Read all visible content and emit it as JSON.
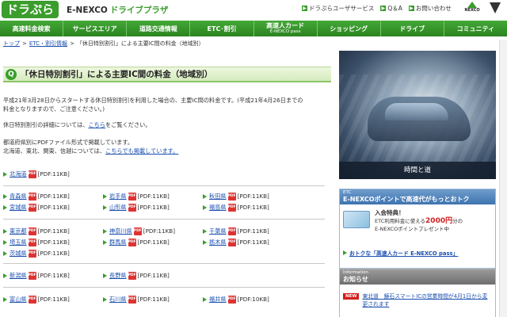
{
  "header": {
    "logo_text": "ドラぷら",
    "brand": "E-NEXCO",
    "brand_sub": "ドライブプラザ",
    "util_links": [
      "ドラぷらユーザサービス",
      "Q＆A",
      "お問い合わせ"
    ],
    "nexco_logo": "NEXCO"
  },
  "nav": {
    "items": [
      {
        "label": "高速料金検索",
        "sub": ""
      },
      {
        "label": "サービスエリア",
        "sub": ""
      },
      {
        "label": "道路交通情報",
        "sub": ""
      },
      {
        "label": "ETC･割引",
        "sub": ""
      },
      {
        "label": "高速人カード",
        "sub": "E-NEXCO pass"
      },
      {
        "label": "ショッピング",
        "sub": ""
      },
      {
        "label": "ドライブ",
        "sub": ""
      },
      {
        "label": "コミュニティ",
        "sub": ""
      }
    ]
  },
  "breadcrumb": {
    "home": "トップ",
    "parent": "ETC・割引情報",
    "current": "「休日特別割引」による主要IC間の料金（地域別）"
  },
  "main": {
    "title": "「休日特別割引」による主要IC間の料金（地域別）",
    "intro_line1": "平成21年3月28日からスタートする休日特別割引を利用した場合の、主要IC間の料金です。(平成21年4月26日までの",
    "intro_line2": "料金となりますので、ご注意ください。)",
    "details_prefix": "休日特別割引の詳細については、",
    "details_link": "こちら",
    "details_suffix": "をご覧ください。",
    "pdf_note": "都道府県別にPDFファイル形式で掲載しています。",
    "region_prefix": "北海道、東北、関東、信越については、",
    "region_link": "こちらでも掲載しています。",
    "pdf_label": "PDF",
    "groups": [
      [
        [
          {
            "name": "北海道",
            "size": "[PDF:11KB]"
          }
        ]
      ],
      [
        [
          {
            "name": "青森県",
            "size": "[PDF:11KB]"
          },
          {
            "name": "宮城県",
            "size": "[PDF:11KB]"
          }
        ],
        [
          {
            "name": "岩手県",
            "size": "[PDF:11KB]"
          },
          {
            "name": "山形県",
            "size": "[PDF:11KB]"
          }
        ],
        [
          {
            "name": "秋田県",
            "size": "[PDF:11KB]"
          },
          {
            "name": "福島県",
            "size": "[PDF:11KB]"
          }
        ]
      ],
      [
        [
          {
            "name": "東京都",
            "size": "[PDF:11KB]"
          },
          {
            "name": "埼玉県",
            "size": "[PDF:11KB]"
          },
          {
            "name": "茨城県",
            "size": "[PDF:11KB]"
          }
        ],
        [
          {
            "name": "神奈川県",
            "size": "[PDF:11KB]"
          },
          {
            "name": "群馬県",
            "size": "[PDF:11KB]"
          }
        ],
        [
          {
            "name": "千葉県",
            "size": "[PDF:11KB]"
          },
          {
            "name": "栃木県",
            "size": "[PDF:11KB]"
          }
        ]
      ],
      [
        [
          {
            "name": "新潟県",
            "size": "[PDF:11KB]"
          }
        ],
        [
          {
            "name": "長野県",
            "size": "[PDF:11KB]"
          }
        ]
      ],
      [
        [
          {
            "name": "富山県",
            "size": "[PDF:11KB]"
          }
        ],
        [
          {
            "name": "石川県",
            "size": "[PDF:11KB]"
          }
        ],
        [
          {
            "name": "福井県",
            "size": "[PDF:10KB]"
          }
        ]
      ]
    ]
  },
  "sidebar": {
    "promo_caption": "時間と道",
    "etc": {
      "tag": "ETC",
      "title": "E-NEXCOポイントで高速代がもっとおトク",
      "line1": "入会特典！",
      "line2_prefix": "ETC利用料金に使える",
      "amount": "2000円",
      "line2_suffix": "分の",
      "line3": "E-NEXCOポイントプレゼント中",
      "link": "おトクな「高速人カード E-NEXCO pass」"
    },
    "info": {
      "tag": "Information",
      "title": "お知らせ",
      "badge": "NEW",
      "news": "東北道　鏡石スマートICの営業時間が4月1日から変更されます"
    }
  }
}
